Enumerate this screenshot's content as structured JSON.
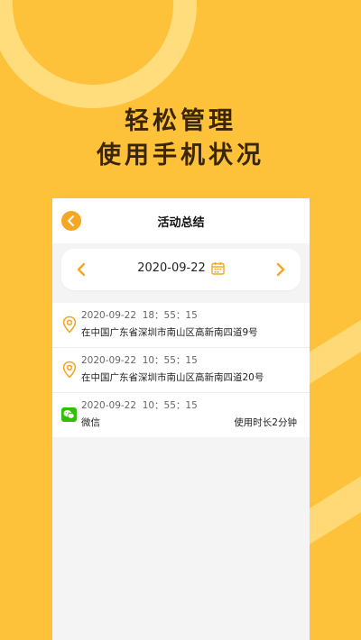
{
  "headline": {
    "line1": "轻松管理",
    "line2": "使用手机状况"
  },
  "app": {
    "title": "活动总结",
    "date": "2020-09-22",
    "accent_color": "#F5A623",
    "background_color": "#FDC13A",
    "icons": {
      "back": "chevron-left-circle-icon",
      "prev": "chevron-left-icon",
      "next": "chevron-right-icon",
      "calendar": "calendar-icon",
      "location": "location-pin-icon",
      "wechat": "wechat-icon"
    },
    "items": [
      {
        "type": "location",
        "time": "2020-09-22  18：55：15",
        "desc": "在中国广东省深圳市南山区高新南四道9号",
        "extra": ""
      },
      {
        "type": "location",
        "time": "2020-09-22  10：55：15",
        "desc": "在中国广东省深圳市南山区高新南四道20号",
        "extra": ""
      },
      {
        "type": "app",
        "time": "2020-09-22  10：55：15",
        "desc": "微信",
        "extra": "使用时长2分钟"
      }
    ]
  }
}
